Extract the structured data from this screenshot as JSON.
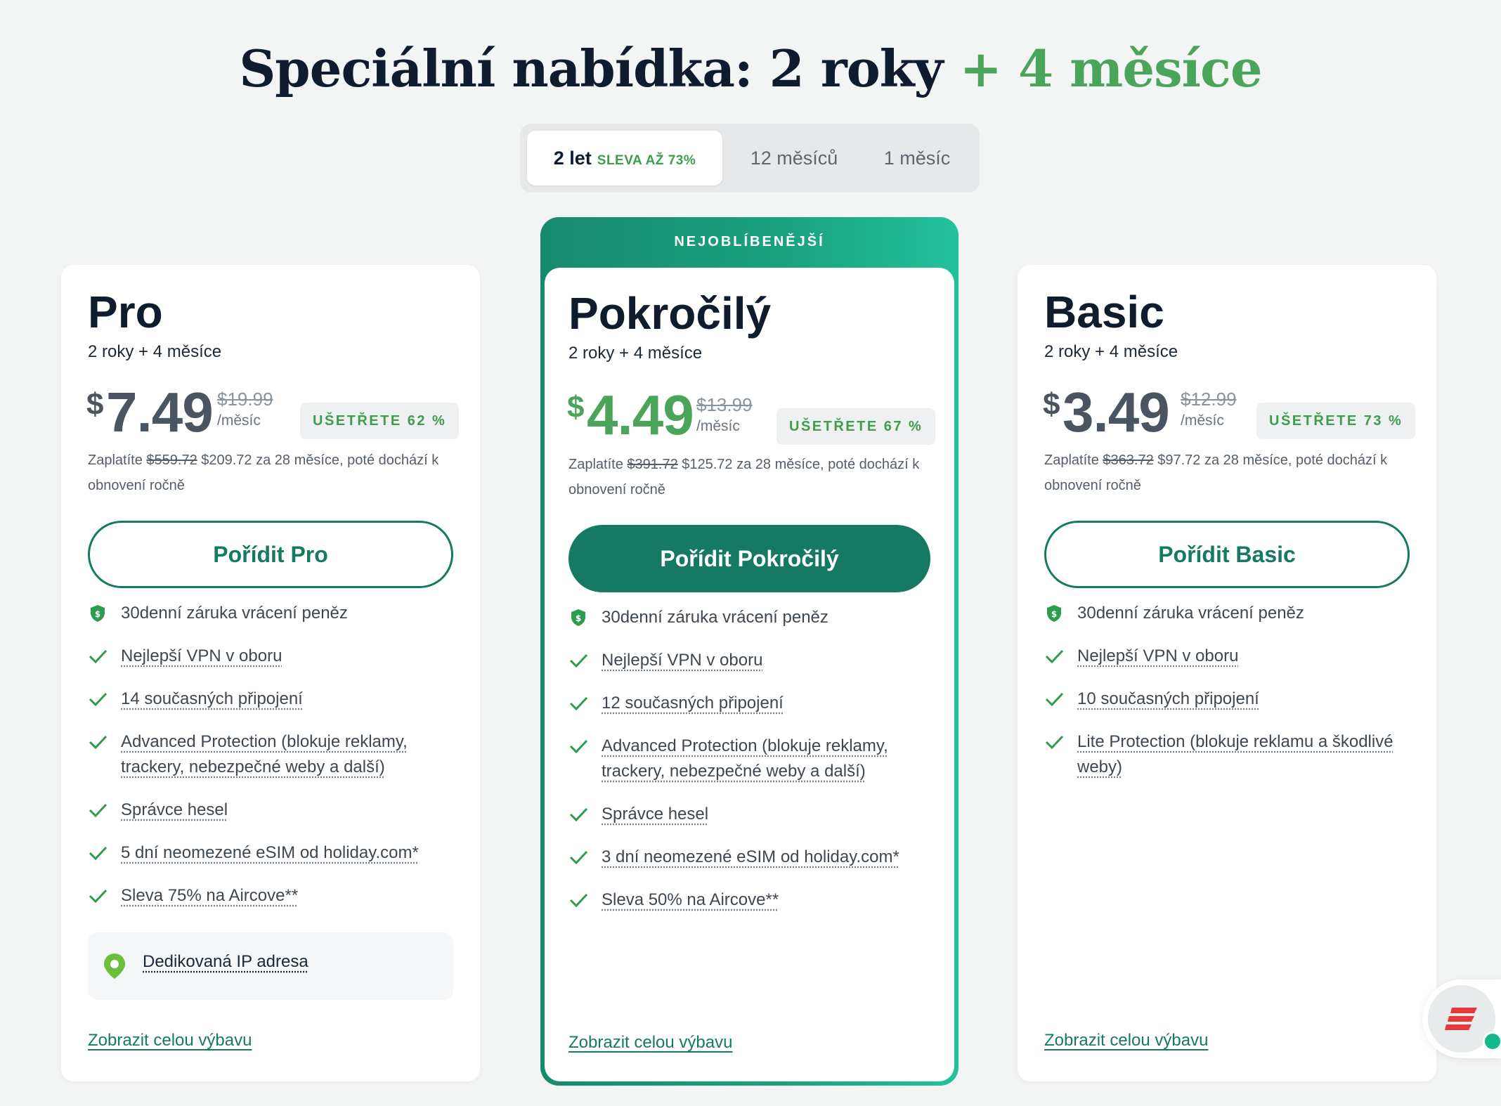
{
  "headline": {
    "main": "Speciální nabídka: 2 roky",
    "accent": "+ 4 měsíce"
  },
  "tabs": {
    "active_label": "2 let",
    "active_badge": "SLEVA AŽ 73%",
    "tab2": "12 měsíců",
    "tab3": "1 měsíc"
  },
  "featured_label": "NEJOBLÍBENĚJŠÍ",
  "plans": {
    "pro": {
      "name": "Pro",
      "term": "2 roky + 4 měsíce",
      "currency": "$",
      "price": "7.49",
      "old_price": "$19.99",
      "per": "/měsíc",
      "save": "UŠETŘETE 62 %",
      "pay_prefix": "Zaplatíte",
      "pay_old": "$559.72",
      "pay_rest": "$209.72 za 28 měsíce, poté dochází k obnovení ročně",
      "cta": "Pořídit Pro",
      "features": [
        "30denní záruka vrácení peněz",
        "Nejlepší VPN v oboru",
        "14 současných připojení",
        "Advanced Protection (blokuje reklamy, trackery, nebezpečné weby a další)",
        "Správce hesel",
        "5 dní neomezené eSIM od holiday.com*",
        "Sleva 75% na Aircove**"
      ],
      "extra": "Dedikovaná IP adresa",
      "more": "Zobrazit celou výbavu"
    },
    "advanced": {
      "name": "Pokročilý",
      "term": "2 roky + 4 měsíce",
      "currency": "$",
      "price": "4.49",
      "old_price": "$13.99",
      "per": "/měsíc",
      "save": "UŠETŘETE 67 %",
      "pay_prefix": "Zaplatíte",
      "pay_old": "$391.72",
      "pay_rest": "$125.72 za 28 měsíce, poté dochází k obnovení ročně",
      "cta": "Pořídit Pokročilý",
      "features": [
        "30denní záruka vrácení peněz",
        "Nejlepší VPN v oboru",
        "12 současných připojení",
        "Advanced Protection (blokuje reklamy, trackery, nebezpečné weby a další)",
        "Správce hesel",
        "3 dní neomezené eSIM od holiday.com*",
        "Sleva 50% na Aircove**"
      ],
      "more": "Zobrazit celou výbavu"
    },
    "basic": {
      "name": "Basic",
      "term": "2 roky + 4 měsíce",
      "currency": "$",
      "price": "3.49",
      "old_price": "$12.99",
      "per": "/měsíc",
      "save": "UŠETŘETE 73 %",
      "pay_prefix": "Zaplatíte",
      "pay_old": "$363.72",
      "pay_rest": "$97.72 za 28 měsíce, poté dochází k obnovení ročně",
      "cta": "Pořídit Basic",
      "features": [
        "30denní záruka vrácení peněz",
        "Nejlepší VPN v oboru",
        "10 současných připojení",
        "Lite Protection (blokuje reklamu a škodlivé weby)"
      ],
      "more": "Zobrazit celou výbavu"
    }
  },
  "colors": {
    "brand": "#167a63",
    "accent_green": "#4aa55a",
    "check": "#2e9c4e",
    "ip_pin": "#6cbf3b",
    "chat_logo": "#e5383b"
  },
  "icons": {
    "guarantee": "shield-dollar-icon",
    "feature": "checkmark-icon",
    "ip": "location-pin-icon",
    "chat": "expressvpn-logo-icon"
  }
}
